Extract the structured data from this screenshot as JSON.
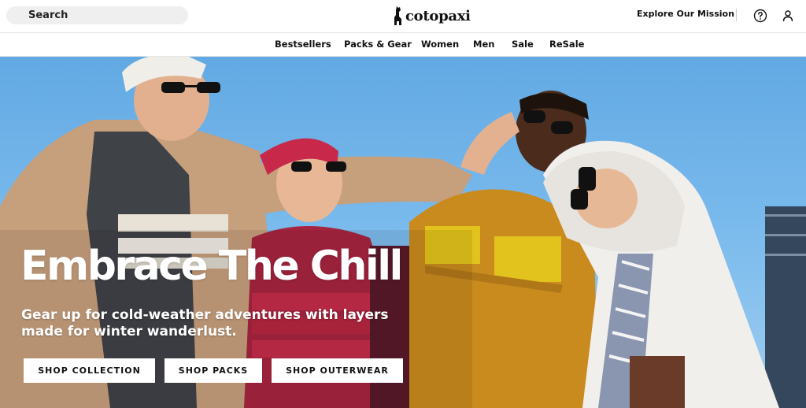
{
  "header": {
    "search_label": "Search",
    "logo_text": "cotopaxi",
    "mission_link": "Explore Our Mission",
    "help_icon": "help-circle-icon",
    "account_icon": "user-icon"
  },
  "nav": {
    "items": [
      "Bestsellers",
      "Packs & Gear",
      "Women",
      "Men",
      "Sale",
      "ReSale"
    ]
  },
  "hero": {
    "headline": "Embrace The Chill",
    "subhead": "Gear up for cold-weather adventures with layers made for winter wanderlust.",
    "buttons": [
      "SHOP COLLECTION",
      "SHOP PACKS",
      "SHOP OUTERWEAR"
    ]
  }
}
